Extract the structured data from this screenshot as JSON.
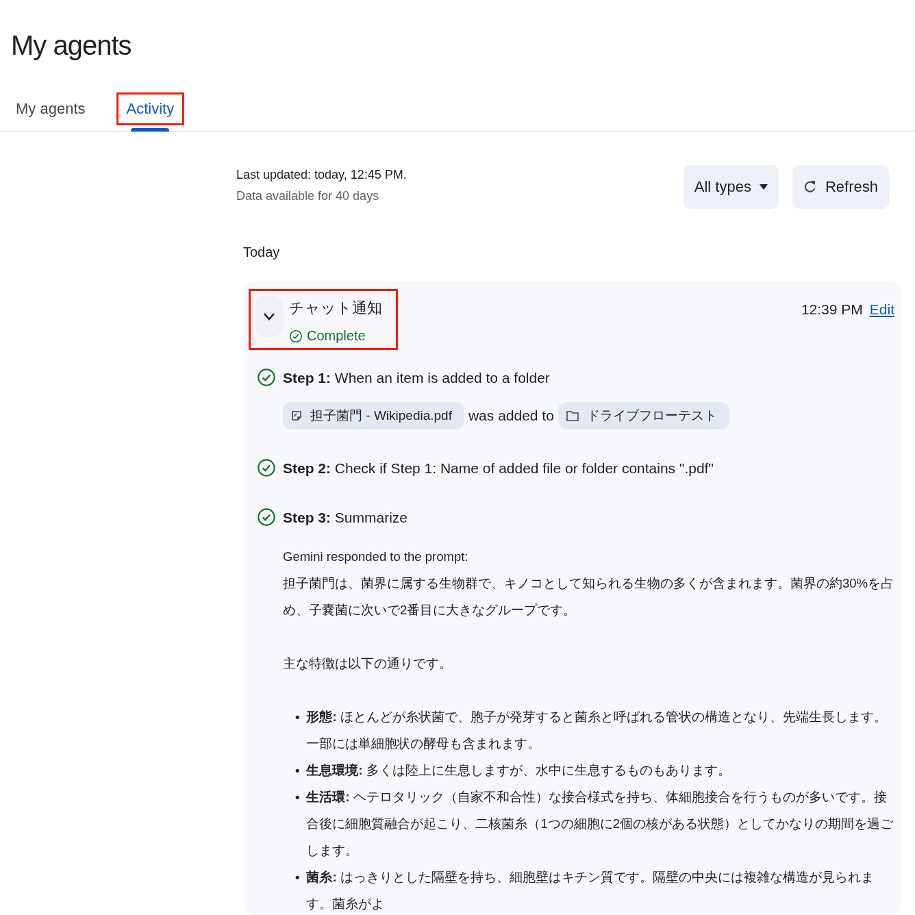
{
  "page_title": "My agents",
  "tabs": [
    {
      "label": "My agents",
      "selected": false,
      "highlighted": false
    },
    {
      "label": "Activity",
      "selected": true,
      "highlighted": true
    }
  ],
  "status": {
    "last_updated": "Last updated: today, 12:45 PM.",
    "retention": "Data available for 40 days"
  },
  "filter": {
    "label": "All types"
  },
  "refresh_button": {
    "label": "Refresh"
  },
  "group_label": "Today",
  "run": {
    "name": "チャット通知",
    "status": "Complete",
    "time": "12:39 PM",
    "edit_link": "Edit",
    "expanded": true,
    "highlighted": true,
    "steps": [
      {
        "kind": "trigger",
        "title": "**Step 1:** When an item is added to a folder",
        "complete": true,
        "file_chip": "担子菌門 - Wikipedia.pdf",
        "connector": "was added to",
        "folder_chip": "ドライブフローテスト"
      },
      {
        "kind": "condition",
        "title": "**Step 2:** Check if Step 1: Name of added file or folder contains \".pdf\"",
        "complete": true
      },
      {
        "kind": "response",
        "title": "**Step 3:** Summarize",
        "complete": true,
        "intro": "Gemini responded to the prompt:",
        "paragraphs": [
          "担子菌門は、菌界に属する生物群で、キノコとして知られる生物の多くが含まれます。菌界の約30%を占め、子嚢菌に次いで2番目に大きなグループです。",
          "主な特徴は以下の通りです。"
        ],
        "bullets": [
          {
            "marker": "•",
            "text": "**形態:** ほとんどが糸状菌で、胞子が発芽すると菌糸と呼ばれる管状の構造となり、先端生長します。一部には単細胞状の酵母も含まれます。"
          },
          {
            "marker": "•",
            "text": "**生息環境:** 多くは陸上に生息しますが、水中に生息するものもあります。"
          },
          {
            "marker": "•",
            "text": "**生活環:** ヘテロタリック（自家不和合性）な接合様式を持ち、体細胞接合を行うものが多いです。接合後に細胞質融合が起こり、二核菌糸（1つの細胞に2個の核がある状態）としてかなりの期間を過ごします。"
          },
          {
            "marker": "•",
            "text": "**菌糸:** はっきりとした隔壁を持ち、細胞壁はキチン質です。隔壁の中央には複雑な構造が見られます。菌糸がよ"
          }
        ]
      }
    ]
  }
}
